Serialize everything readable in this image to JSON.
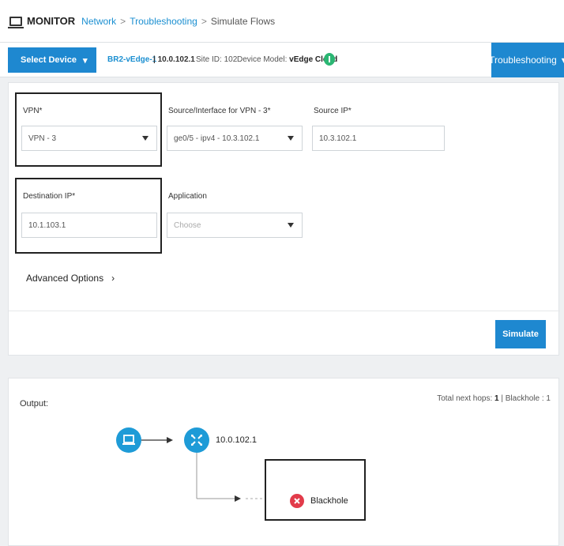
{
  "header": {
    "section": "MONITOR",
    "breadcrumb": [
      "Network",
      "Troubleshooting"
    ],
    "separator": ">",
    "current": "Simulate Flows"
  },
  "device_bar": {
    "select_device_label": "Select Device",
    "device_name": "BR2-vEdge-1",
    "device_ip": "| 10.0.102.1",
    "site_id": "Site ID: 102",
    "device_model_label": "Device Model:",
    "device_model_value": "vEdge Cloud",
    "troubleshooting_label": "Troubleshooting"
  },
  "form": {
    "vpn_label": "VPN*",
    "vpn_value": "VPN - 3",
    "source_interface_label": "Source/Interface for VPN - 3*",
    "source_interface_value": "ge0/5 - ipv4 - 10.3.102.1",
    "source_ip_label": "Source IP*",
    "source_ip_value": "10.3.102.1",
    "destination_ip_label": "Destination IP*",
    "destination_ip_value": "10.1.103.1",
    "application_label": "Application",
    "application_placeholder": "Choose",
    "advanced_options_label": "Advanced Options",
    "simulate_label": "Simulate"
  },
  "output": {
    "label": "Output:",
    "hops_prefix": "Total next hops:",
    "hops_count": "1",
    "blackhole_count_text": "| Blackhole : 1",
    "next_hop_ip": "10.0.102.1",
    "blackhole_label": "Blackhole"
  },
  "colors": {
    "accent": "#1e88d0",
    "status_green": "#2bb673",
    "node_blue": "#1e9bd7",
    "blackhole_red": "#e23b4a"
  },
  "icons": {
    "monitor": "monitor-icon",
    "laptop": "laptop-icon",
    "router": "router-icon",
    "blackhole": "close-circle-icon"
  }
}
